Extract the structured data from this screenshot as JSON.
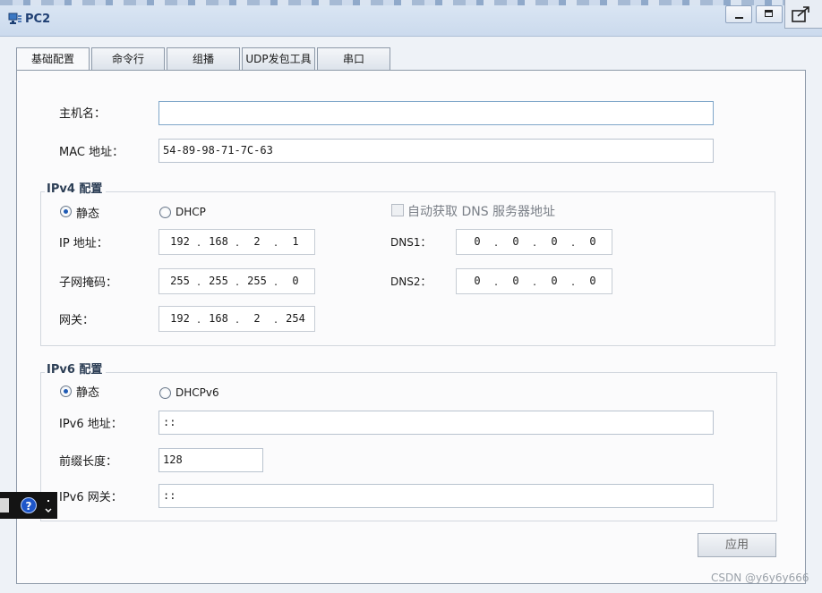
{
  "window": {
    "title": "PC2"
  },
  "tabs": [
    {
      "label": "基础配置",
      "active": true
    },
    {
      "label": "命令行"
    },
    {
      "label": "组播"
    },
    {
      "label": "UDP发包工具"
    },
    {
      "label": "串口"
    }
  ],
  "basic": {
    "hostname_label": "主机名：",
    "hostname_value": "",
    "mac_label": "MAC 地址：",
    "mac_value": "54-89-98-71-7C-63"
  },
  "ipv4": {
    "title": "IPv4 配置",
    "static_label": "静态",
    "dhcp_label": "DHCP",
    "auto_dns_label": "自动获取 DNS 服务器地址",
    "ip_label": "IP 地址：",
    "ip": [
      "192",
      "168",
      "2",
      "1"
    ],
    "mask_label": "子网掩码：",
    "mask": [
      "255",
      "255",
      "255",
      "0"
    ],
    "gateway_label": "网关：",
    "gateway": [
      "192",
      "168",
      "2",
      "254"
    ],
    "dns1_label": "DNS1：",
    "dns1": [
      "0",
      "0",
      "0",
      "0"
    ],
    "dns2_label": "DNS2：",
    "dns2": [
      "0",
      "0",
      "0",
      "0"
    ]
  },
  "ipv6": {
    "title": "IPv6 配置",
    "static_label": "静态",
    "dhcp_label": "DHCPv6",
    "addr_label": "IPv6 地址：",
    "addr_value": "::",
    "prefix_label": "前缀长度：",
    "prefix_value": "128",
    "gateway_label": "IPv6 网关：",
    "gateway_value": "::"
  },
  "apply_label": "应用",
  "helper": {
    "help_glyph": "?"
  },
  "watermark": "CSDN @y6y6y666",
  "colors": {
    "accent": "#1e5ab4",
    "title": "#1f3f73"
  }
}
